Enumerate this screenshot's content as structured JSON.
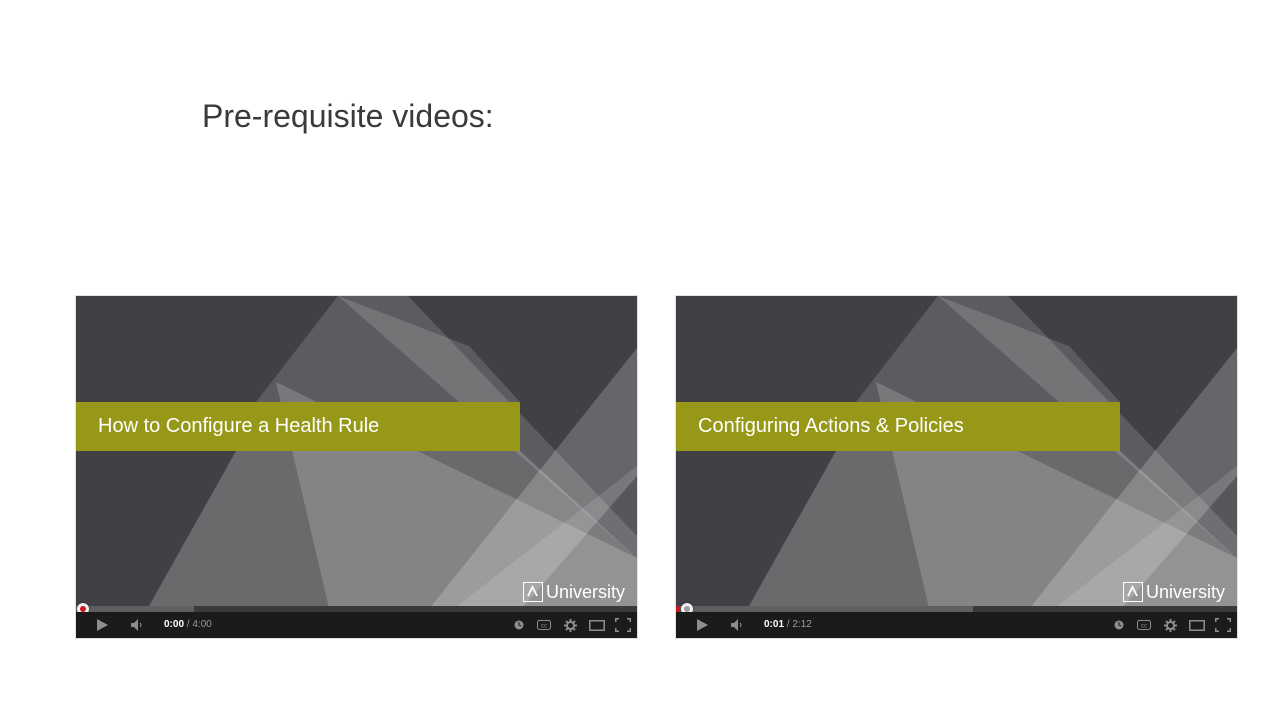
{
  "page": {
    "title": "Pre-requisite videos:"
  },
  "videos": [
    {
      "title": "How to Configure a Health Rule",
      "logo_text": "University",
      "current_time": "0:00",
      "duration": "4:00",
      "separator": " / ",
      "played_fraction": 0.0,
      "loaded_fraction": 0.21
    },
    {
      "title": "Configuring Actions & Policies",
      "logo_text": "University",
      "current_time": "0:01",
      "duration": "2:12",
      "separator": " / ",
      "played_fraction": 0.008,
      "loaded_fraction": 0.53
    }
  ],
  "controls": {
    "icons": [
      "play-icon",
      "volume-icon",
      "watch-later-icon",
      "captions-icon",
      "settings-icon",
      "theater-mode-icon",
      "fullscreen-icon"
    ]
  },
  "colors": {
    "banner": "#979818",
    "background": "#404045",
    "progress_played": "#cc181e",
    "control_bar": "#1b1b1b"
  }
}
